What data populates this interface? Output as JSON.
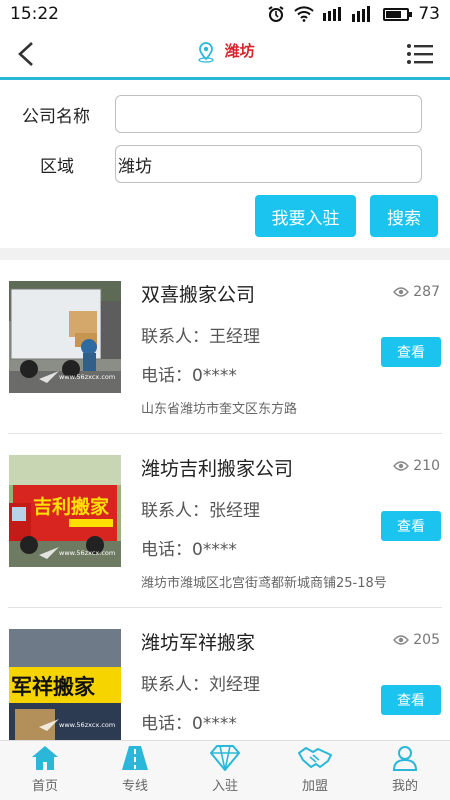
{
  "status": {
    "time": "15:22",
    "battery": "73",
    "battery_level": 0.73
  },
  "header": {
    "title": "潍坊",
    "accent_color": "#2bb8d8",
    "title_color": "#d8252b"
  },
  "search_form": {
    "company_label": "公司名称",
    "company_value": "",
    "region_label": "区域",
    "region_value": "潍坊",
    "join_button": "我要入驻",
    "search_button": "搜索"
  },
  "companies": [
    {
      "name": "双喜搬家公司",
      "views": "287",
      "contact": "联系人：王经理",
      "phone": "电话：0****",
      "address": "山东省潍坊市奎文区东方路",
      "view_button": "查看",
      "thumb_watermark": "www.56zxcx.com"
    },
    {
      "name": "潍坊吉利搬家公司",
      "views": "210",
      "contact": "联系人：张经理",
      "phone": "电话：0****",
      "address": "潍坊市潍城区北宫街鸢都新城商铺25-18号",
      "view_button": "查看",
      "thumb_text": "吉利搬家",
      "thumb_watermark": "www.56zxcx.com"
    },
    {
      "name": "潍坊军祥搬家",
      "views": "205",
      "contact": "联系人：刘经理",
      "phone": "电话：0****",
      "address": "",
      "view_button": "查看",
      "thumb_text": "军祥搬家",
      "thumb_watermark": "www.56zxcx.com"
    }
  ],
  "tabbar": [
    {
      "label": "首页",
      "icon": "home-icon"
    },
    {
      "label": "专线",
      "icon": "road-icon"
    },
    {
      "label": "入驻",
      "icon": "diamond-icon"
    },
    {
      "label": "加盟",
      "icon": "handshake-icon"
    },
    {
      "label": "我的",
      "icon": "user-icon"
    }
  ],
  "colors": {
    "button_blue": "#1ac4ef",
    "tab_icon": "#2bb8d8"
  }
}
